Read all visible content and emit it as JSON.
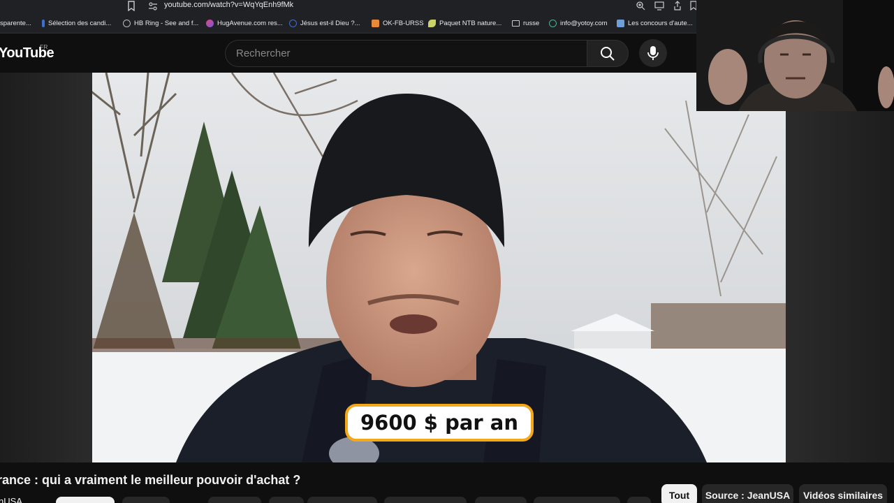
{
  "browser": {
    "url": "youtube.com/watch?v=WqYqEnh9fMk",
    "bookmarks": [
      {
        "label": "sparente...",
        "color": "#202124"
      },
      {
        "label": "Sélection des candi...",
        "color": "#3b6fd4"
      },
      {
        "label": "HB Ring - See and f...",
        "color": "#bdbdbd"
      },
      {
        "label": "HugAvenue.com res...",
        "color": "#e8437a"
      },
      {
        "label": "Jésus est-il Dieu ?...",
        "color": "#3b6fd4"
      },
      {
        "label": "OK-FB-URSS",
        "color": "#e8893a"
      },
      {
        "label": "Paquet NTB nature...",
        "color": "#c9d36a"
      },
      {
        "label": "russe",
        "color": "folder"
      },
      {
        "label": "info@yotoy.com",
        "color": "#4bb38d"
      },
      {
        "label": "Les concours d'aute...",
        "color": "#6f9fd8"
      }
    ]
  },
  "youtube": {
    "logo": "YouTube",
    "region": "FR",
    "search_placeholder": "Rechercher",
    "video": {
      "caption": "9600 $ par an",
      "title": "rance : qui a vraiment le meilleur pouvoir d'achat ?",
      "channel": "nUSA"
    },
    "chips": [
      "Tout",
      "Source : JeanUSA",
      "Vidéos similaires"
    ]
  },
  "colors": {
    "caption_border": "#f3a81b",
    "chip_active_bg": "#f1f1f1",
    "header_bg": "#0f0f0f"
  }
}
